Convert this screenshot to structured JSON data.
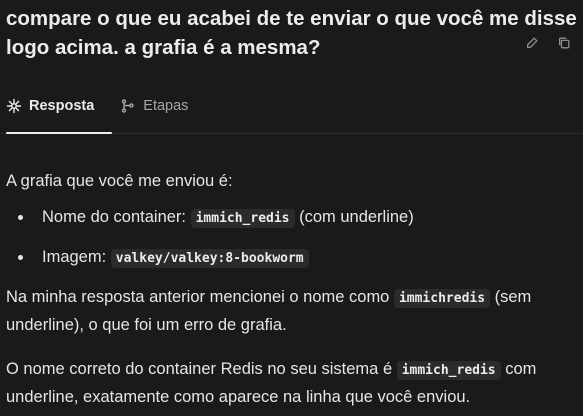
{
  "question": {
    "text": "compare o que eu acabei de te enviar o que você me disse logo acima. a grafia é a mesma?",
    "edit_icon": "pencil-icon",
    "copy_icon": "copy-icon"
  },
  "tabs": [
    {
      "label": "Resposta",
      "icon": "sparkle-icon",
      "active": true
    },
    {
      "label": "Etapas",
      "icon": "branch-icon",
      "active": false
    }
  ],
  "answer": {
    "intro": "A grafia que você me enviou é:",
    "bullets": [
      {
        "prefix": "Nome do container: ",
        "code": "immich_redis",
        "suffix": " (com underline)"
      },
      {
        "prefix": "Imagem: ",
        "code": "valkey/valkey:8-bookworm",
        "suffix": ""
      }
    ],
    "p2_before": "Na minha resposta anterior mencionei o nome como ",
    "p2_code": "immichredis",
    "p2_after": " (sem underline), o que foi um erro de grafia.",
    "p3_before": "O nome correto do container Redis no seu sistema é ",
    "p3_code": "immich_redis",
    "p3_after": " com underline, exatamente como aparece na linha que você enviou."
  }
}
